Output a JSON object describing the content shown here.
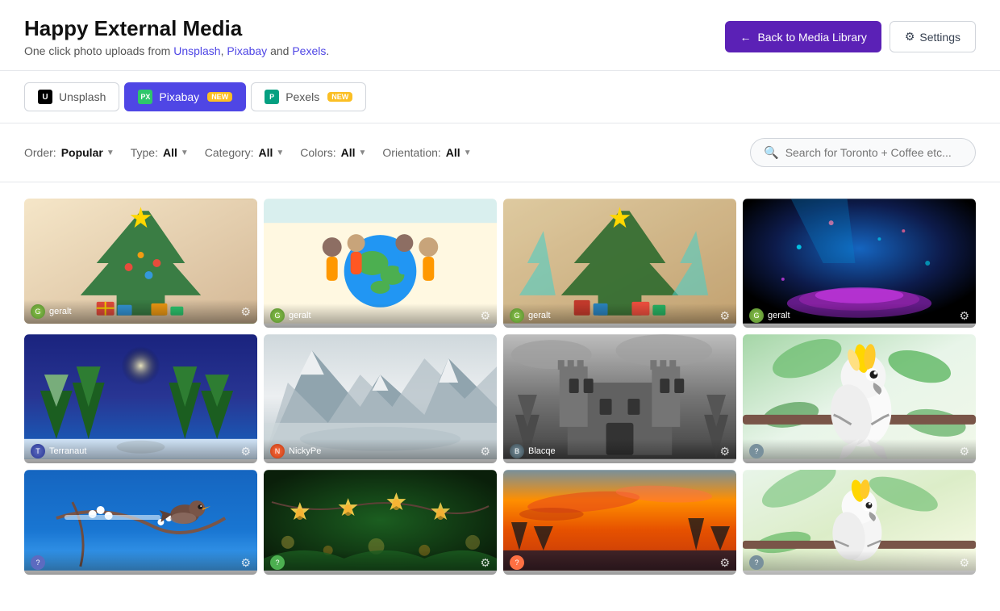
{
  "header": {
    "title": "Happy External Media",
    "subtitle_text": "One click photo uploads from",
    "subtitle_links": [
      "Unsplash",
      "Pixabay",
      "Pexels"
    ],
    "btn_back_label": "Back to Media Library",
    "btn_settings_label": "Settings"
  },
  "tabs": [
    {
      "id": "unsplash",
      "label": "Unsplash",
      "badge": null,
      "active": false
    },
    {
      "id": "pixabay",
      "label": "Pixabay",
      "badge": "NEW",
      "active": true
    },
    {
      "id": "pexels",
      "label": "Pexels",
      "badge": "NEW",
      "active": false
    }
  ],
  "filters": {
    "order_label": "Order:",
    "order_value": "Popular",
    "type_label": "Type:",
    "type_value": "All",
    "category_label": "Category:",
    "category_value": "All",
    "colors_label": "Colors:",
    "colors_value": "All",
    "orientation_label": "Orientation:",
    "orientation_value": "All",
    "search_placeholder": "Search for Toronto + Coffee etc..."
  },
  "photos": {
    "row1": [
      {
        "author": "geralt",
        "has_avatar": true,
        "av_class": "av-geralt"
      },
      {
        "author": "geralt",
        "has_avatar": true,
        "av_class": "av-geralt"
      },
      {
        "author": "geralt",
        "has_avatar": true,
        "av_class": "av-geralt"
      },
      {
        "author": "geralt",
        "has_avatar": true,
        "av_class": "av-geralt"
      }
    ],
    "row2": [
      {
        "author": "Terranaut",
        "has_avatar": true,
        "av_class": "av-terranaut"
      },
      {
        "author": "NickyPe",
        "has_avatar": true,
        "av_class": "av-nickyp"
      },
      {
        "author": "Blacqe",
        "has_avatar": true,
        "av_class": "av-blacqe"
      },
      {
        "author": "",
        "has_avatar": false
      }
    ],
    "row3": [
      {
        "author": "",
        "has_avatar": false
      },
      {
        "author": "",
        "has_avatar": false
      },
      {
        "author": "",
        "has_avatar": false
      },
      {
        "author": "",
        "has_avatar": false
      }
    ]
  }
}
